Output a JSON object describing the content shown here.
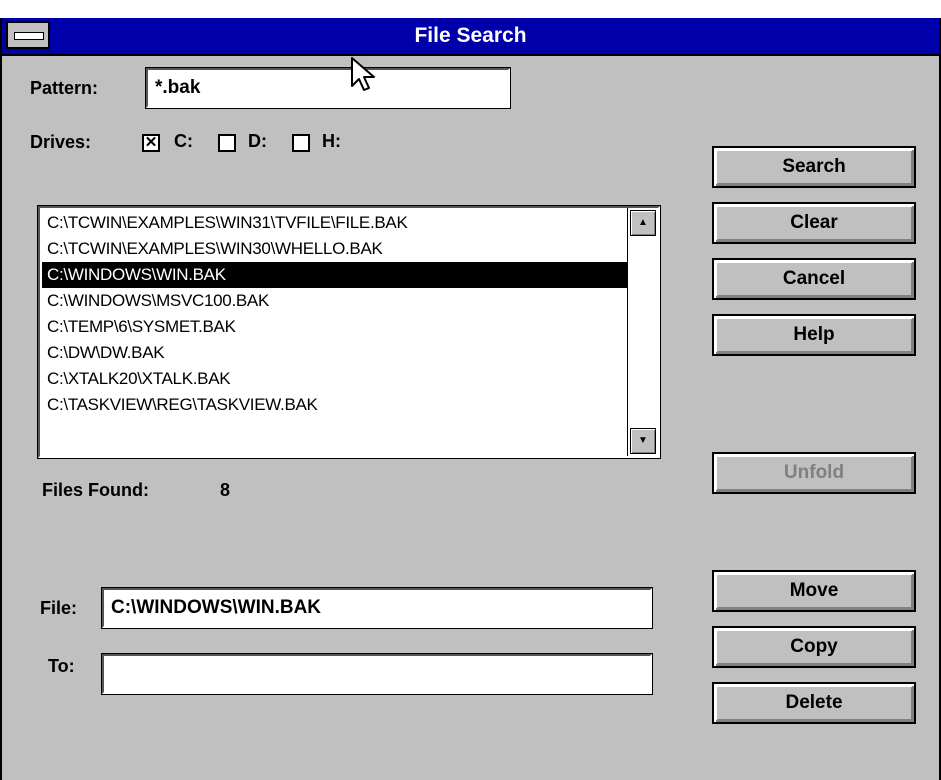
{
  "window": {
    "title": "File Search"
  },
  "pattern": {
    "label": "Pattern:",
    "value": "*.bak"
  },
  "drives": {
    "label": "Drives:",
    "items": [
      {
        "label": "C:",
        "checked": true
      },
      {
        "label": "D:",
        "checked": false
      },
      {
        "label": "H:",
        "checked": false
      }
    ]
  },
  "results": {
    "items": [
      "C:\\TCWIN\\EXAMPLES\\WIN31\\TVFILE\\FILE.BAK",
      "C:\\TCWIN\\EXAMPLES\\WIN30\\WHELLO.BAK",
      "C:\\WINDOWS\\WIN.BAK",
      "C:\\WINDOWS\\MSVC100.BAK",
      "C:\\TEMP\\6\\SYSMET.BAK",
      "C:\\DW\\DW.BAK",
      "C:\\XTALK20\\XTALK.BAK",
      "C:\\TASKVIEW\\REG\\TASKVIEW.BAK"
    ],
    "selected_index": 2
  },
  "files_found": {
    "label": "Files Found:",
    "count": "8"
  },
  "file": {
    "label": "File:",
    "value": "C:\\WINDOWS\\WIN.BAK"
  },
  "to": {
    "label": "To:",
    "value": ""
  },
  "buttons": {
    "search": "Search",
    "clear": "Clear",
    "cancel": "Cancel",
    "help": "Help",
    "unfold": "Unfold",
    "move": "Move",
    "copy": "Copy",
    "delete": "Delete"
  }
}
